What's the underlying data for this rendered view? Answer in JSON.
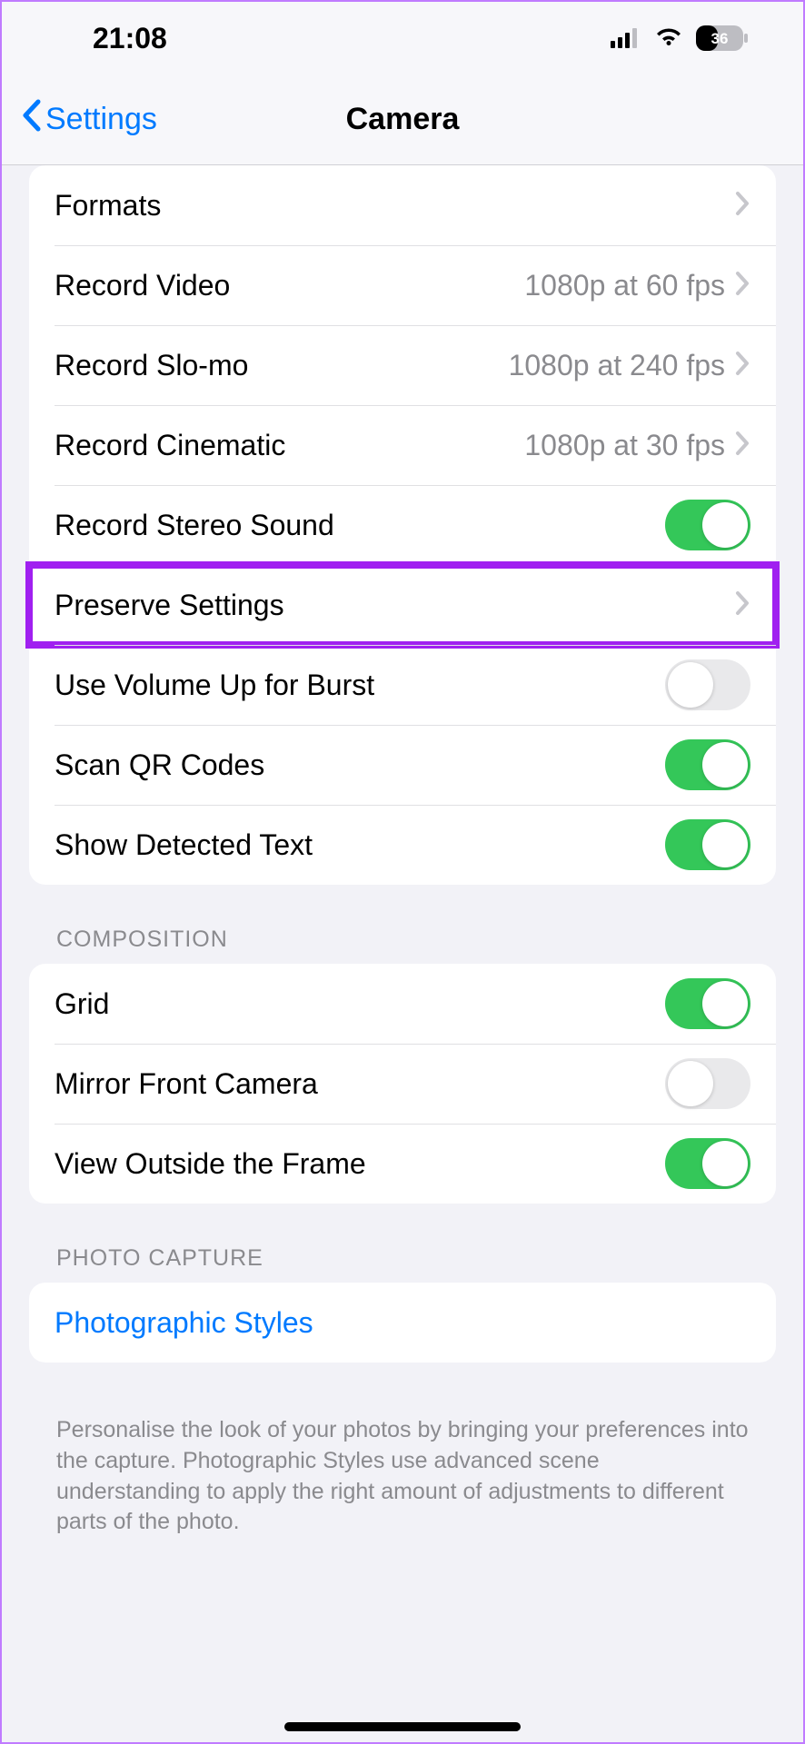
{
  "status": {
    "time": "21:08",
    "battery": "36"
  },
  "nav": {
    "back": "Settings",
    "title": "Camera"
  },
  "sections": [
    {
      "rows": [
        {
          "label": "Formats",
          "type": "disclosure"
        },
        {
          "label": "Record Video",
          "value": "1080p at 60 fps",
          "type": "disclosure"
        },
        {
          "label": "Record Slo-mo",
          "value": "1080p at 240 fps",
          "type": "disclosure"
        },
        {
          "label": "Record Cinematic",
          "value": "1080p at 30 fps",
          "type": "disclosure"
        },
        {
          "label": "Record Stereo Sound",
          "type": "toggle",
          "on": true
        },
        {
          "label": "Preserve Settings",
          "type": "disclosure",
          "highlighted": true
        },
        {
          "label": "Use Volume Up for Burst",
          "type": "toggle",
          "on": false
        },
        {
          "label": "Scan QR Codes",
          "type": "toggle",
          "on": true
        },
        {
          "label": "Show Detected Text",
          "type": "toggle",
          "on": true
        }
      ]
    },
    {
      "header": "COMPOSITION",
      "rows": [
        {
          "label": "Grid",
          "type": "toggle",
          "on": true
        },
        {
          "label": "Mirror Front Camera",
          "type": "toggle",
          "on": false
        },
        {
          "label": "View Outside the Frame",
          "type": "toggle",
          "on": true
        }
      ]
    },
    {
      "header": "PHOTO CAPTURE",
      "rows": [
        {
          "label": "Photographic Styles",
          "type": "link"
        }
      ],
      "footer": "Personalise the look of your photos by bringing your preferences into the capture. Photographic Styles use advanced scene understanding to apply the right amount of adjustments to different parts of the photo."
    }
  ]
}
